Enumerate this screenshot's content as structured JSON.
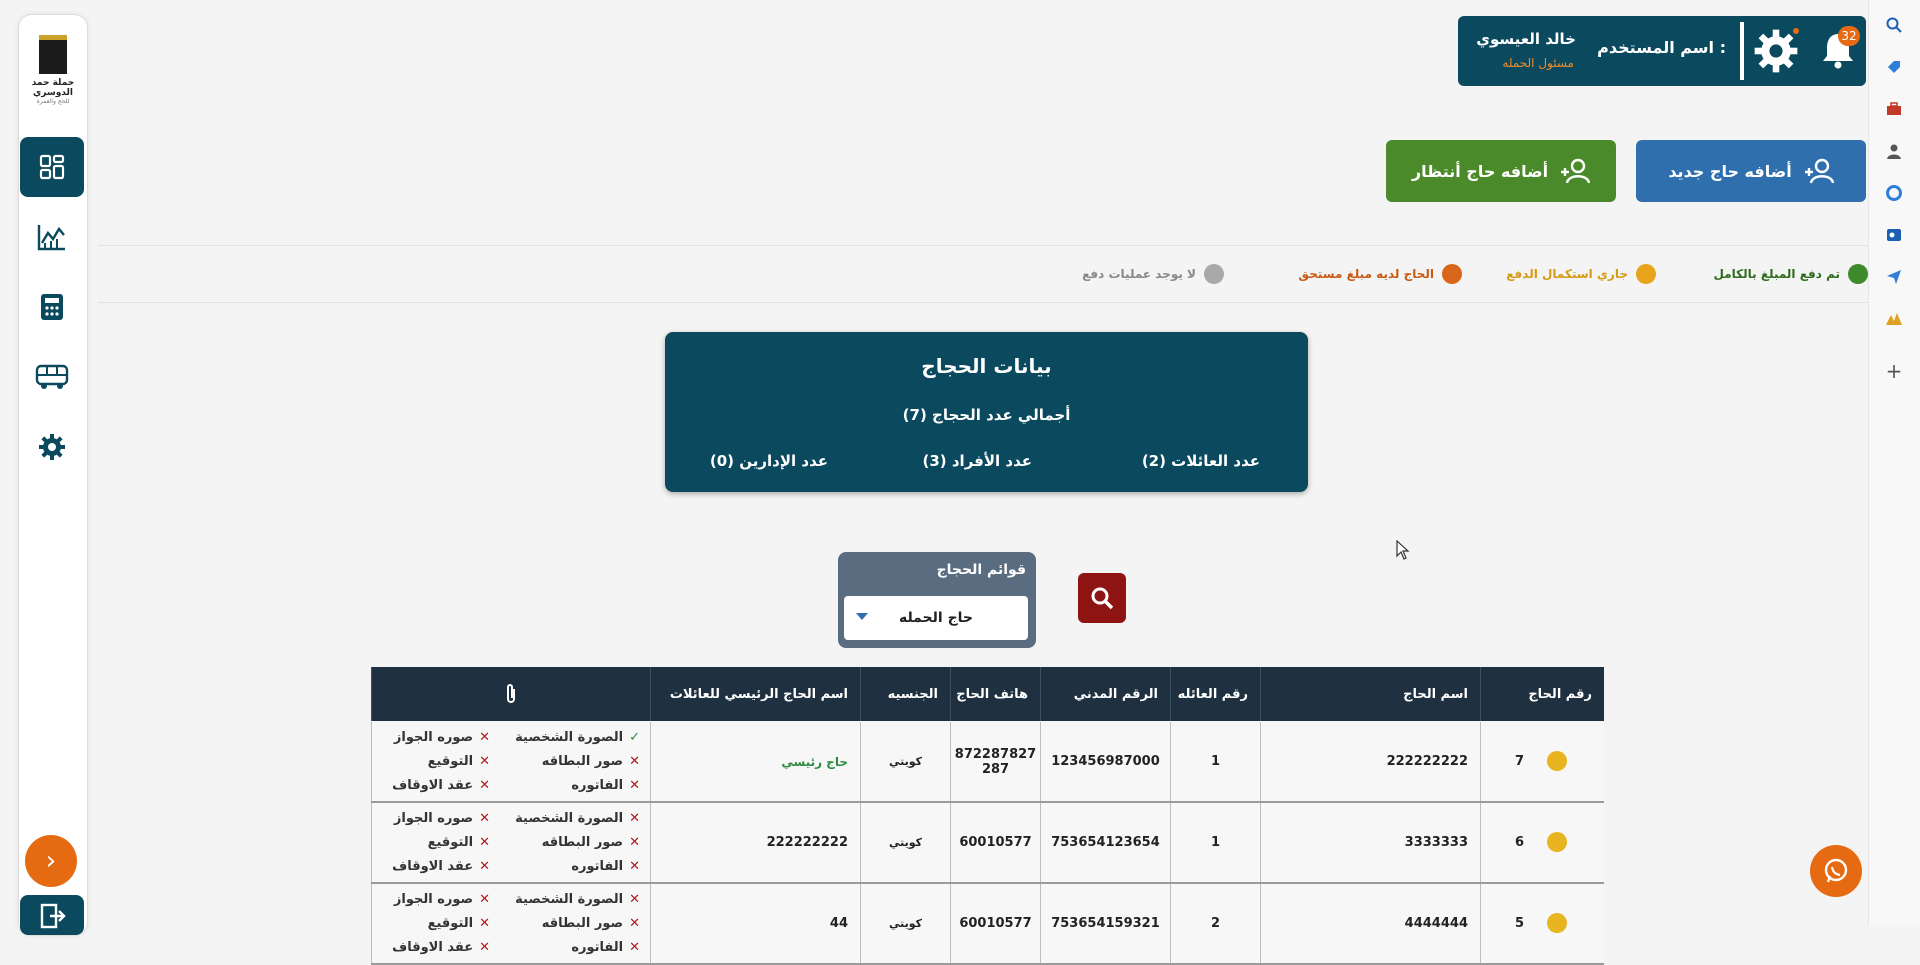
{
  "sidebar": {
    "logo_text": "حملة حمد الدوسري",
    "logo_sub": "للحج والعمرة",
    "items": [
      {
        "name": "dashboard",
        "icon": "grid-icon"
      },
      {
        "name": "reports",
        "icon": "chart-icon"
      },
      {
        "name": "accounting",
        "icon": "calculator-icon"
      },
      {
        "name": "transport",
        "icon": "bus-icon"
      },
      {
        "name": "settings",
        "icon": "gear-icon"
      }
    ]
  },
  "header": {
    "user_label": "اسم المستخدم :",
    "user_name": "خالد العيسوي",
    "user_role": "مسئول الحمله",
    "notification_count": "32"
  },
  "actions": {
    "add_new": "أضافه حاج جديد",
    "add_waiting": "أضافه حاج أنتظار"
  },
  "legend": [
    {
      "label": "تم دفع المبلغ بالكامل",
      "color": "#3e8a2a"
    },
    {
      "label": "جاري استكمال الدفع",
      "color": "#e8a51c"
    },
    {
      "label": "الحاج لديه مبلغ مستحق",
      "color": "#d9661a"
    },
    {
      "label": "لا يوجد عمليات دفع",
      "color": "#a9a9a9"
    }
  ],
  "stats": {
    "title": "بيانات الحجاج",
    "total": "أجمالي عدد الحجاج (7)",
    "families": "عدد العائلات (2)",
    "members": "عدد الأفراد (3)",
    "admins": "عدد الإدارين (0)"
  },
  "filter": {
    "label": "قوائم الحجاج",
    "selected": "حاج الحمله"
  },
  "table": {
    "headers": [
      "رقم الحاج",
      "اسم الحاج",
      "رقم العائله",
      "الرقم المدني",
      "هاتف الحاج",
      "الجنسيه",
      "اسم الحاج الرئيسي للعائلات",
      ""
    ],
    "rows": [
      {
        "status": "#e8b420",
        "number": "7",
        "name": "222222222",
        "family": "1",
        "civil": "123456987000",
        "phone": "872287827 287",
        "nationality": "كويتي",
        "main": "حاج رئيسي",
        "docs": {
          "personal": "ok",
          "card": "no",
          "invoice": "no",
          "passport": "no",
          "signature": "no",
          "waqf": "no"
        }
      },
      {
        "status": "#e8b420",
        "number": "6",
        "name": "3333333",
        "family": "1",
        "civil": "753654123654",
        "phone": "60010577",
        "nationality": "كويتي",
        "main": "222222222",
        "docs": {
          "personal": "no",
          "card": "no",
          "invoice": "no",
          "passport": "no",
          "signature": "no",
          "waqf": "no"
        }
      },
      {
        "status": "#e8b420",
        "number": "5",
        "name": "4444444",
        "family": "2",
        "civil": "753654159321",
        "phone": "60010577",
        "nationality": "كويتي",
        "main": "44",
        "docs": {
          "personal": "no",
          "card": "no",
          "invoice": "no",
          "passport": "no",
          "signature": "no",
          "waqf": "no"
        }
      }
    ],
    "doc_labels": {
      "personal": "الصورة الشخصية",
      "card": "صور البطاقه",
      "invoice": "الفاتوره",
      "passport": "صوره الجواز",
      "signature": "التوقيع",
      "waqf": "عقد الاوقاف"
    }
  }
}
